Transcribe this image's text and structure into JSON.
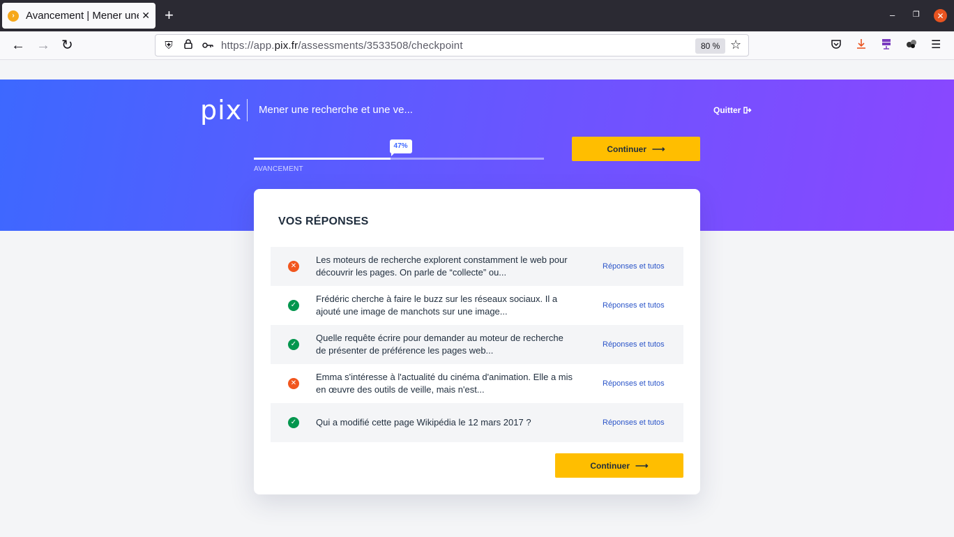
{
  "browser": {
    "tab_title": "Avancement | Mener une",
    "tab_close": "✕",
    "new_tab": "+",
    "url_prefix": "https://app.",
    "url_domain": "pix.fr",
    "url_path": "/assessments/3533508/checkpoint",
    "zoom": "80 %"
  },
  "header": {
    "logo": "pix",
    "assessment_title": "Mener une recherche et une ve...",
    "quit_label": "Quitter"
  },
  "progress": {
    "percent_label": "47%",
    "value": 0.47,
    "label": "AVANCEMENT"
  },
  "continue_label": "Continuer",
  "card": {
    "title": "VOS RÉPONSES",
    "answers": [
      {
        "status": "ko",
        "text": "Les moteurs de recherche explorent constamment le web pour découvrir les pages. On parle de “collecte” ou...",
        "link": "Réponses et tutos"
      },
      {
        "status": "ok",
        "text": "Frédéric cherche à faire le buzz sur les réseaux sociaux. Il a ajouté une image de manchots sur une image...",
        "link": "Réponses et tutos"
      },
      {
        "status": "ok",
        "text": "Quelle requête écrire pour demander au moteur de recherche de présenter de préférence les pages web...",
        "link": "Réponses et tutos"
      },
      {
        "status": "ko",
        "text": "Emma s'intéresse à l'actualité du cinéma d'animation. Elle a mis en œuvre des outils de veille, mais n'est...",
        "link": "Réponses et tutos"
      },
      {
        "status": "ok",
        "text": "Qui a modifié cette page Wikipédia le 12 mars 2017 ?",
        "link": "Réponses et tutos"
      }
    ]
  },
  "colors": {
    "accent_yellow": "#ffbe00",
    "banner_start": "#3d68ff",
    "banner_end": "#8a47ff",
    "status_ok": "#03964e",
    "status_ko": "#f1561e"
  }
}
